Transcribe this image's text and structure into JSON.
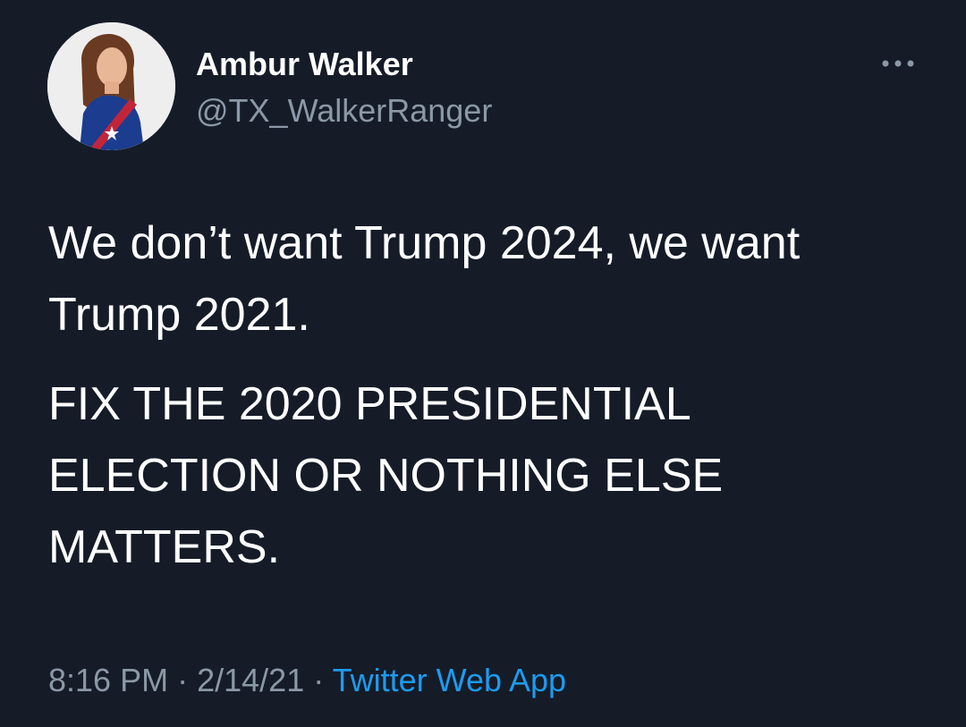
{
  "author": {
    "display_name": "Ambur Walker",
    "handle": "@TX_WalkerRanger",
    "avatar_icon": "profile-photo"
  },
  "menu": {
    "icon": "more-options-icon"
  },
  "tweet": {
    "line1": "We don’t want Trump 2024, we want Trump 2021.",
    "line2": "FIX THE 2020 PRESIDENTIAL ELECTION OR NOTHING ELSE MATTERS."
  },
  "meta": {
    "time": "8:16 PM",
    "separator": "·",
    "date": "2/14/21",
    "source": "Twitter Web App"
  },
  "colors": {
    "background": "#151c28",
    "primary_text": "#ffffff",
    "secondary_text": "#8b98a5",
    "link": "#1d9bf0"
  }
}
